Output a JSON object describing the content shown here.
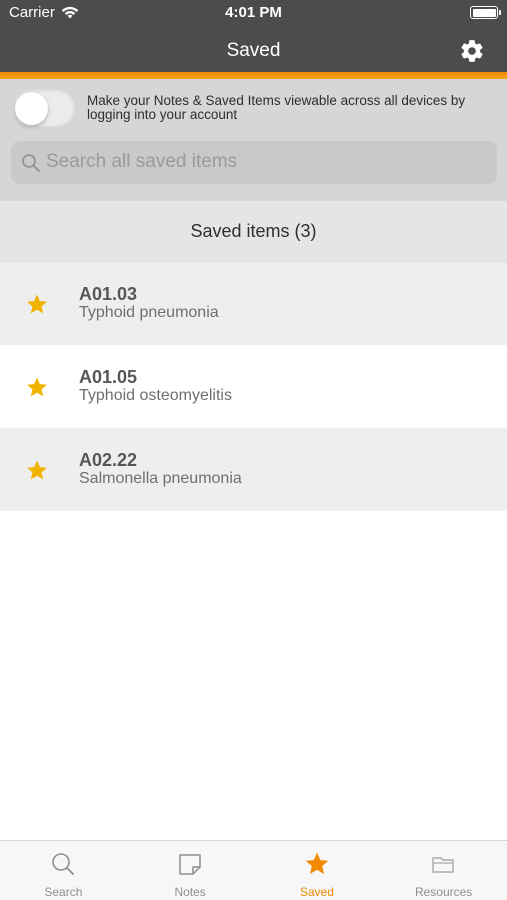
{
  "status_bar": {
    "carrier": "Carrier",
    "time": "4:01 PM"
  },
  "nav": {
    "title": "Saved",
    "settings_icon": "gear-icon"
  },
  "accent_color": "#f08a00",
  "sync": {
    "toggle_on": false,
    "message": "Make your Notes & Saved Items viewable across all devices by logging into your account"
  },
  "search": {
    "placeholder": "Search all saved items"
  },
  "section": {
    "title": "Saved items (3)"
  },
  "saved_items": [
    {
      "code": "A01.03",
      "description": "Typhoid pneumonia",
      "icon": "star-icon"
    },
    {
      "code": "A01.05",
      "description": "Typhoid osteomyelitis",
      "icon": "star-icon"
    },
    {
      "code": "A02.22",
      "description": "Salmonella pneumonia",
      "icon": "star-icon"
    }
  ],
  "tabs": [
    {
      "label": "Search",
      "icon": "search-icon",
      "active": false
    },
    {
      "label": "Notes",
      "icon": "notes-icon",
      "active": false
    },
    {
      "label": "Saved",
      "icon": "star-icon",
      "active": true
    },
    {
      "label": "Resources",
      "icon": "folder-icon",
      "active": false
    }
  ]
}
